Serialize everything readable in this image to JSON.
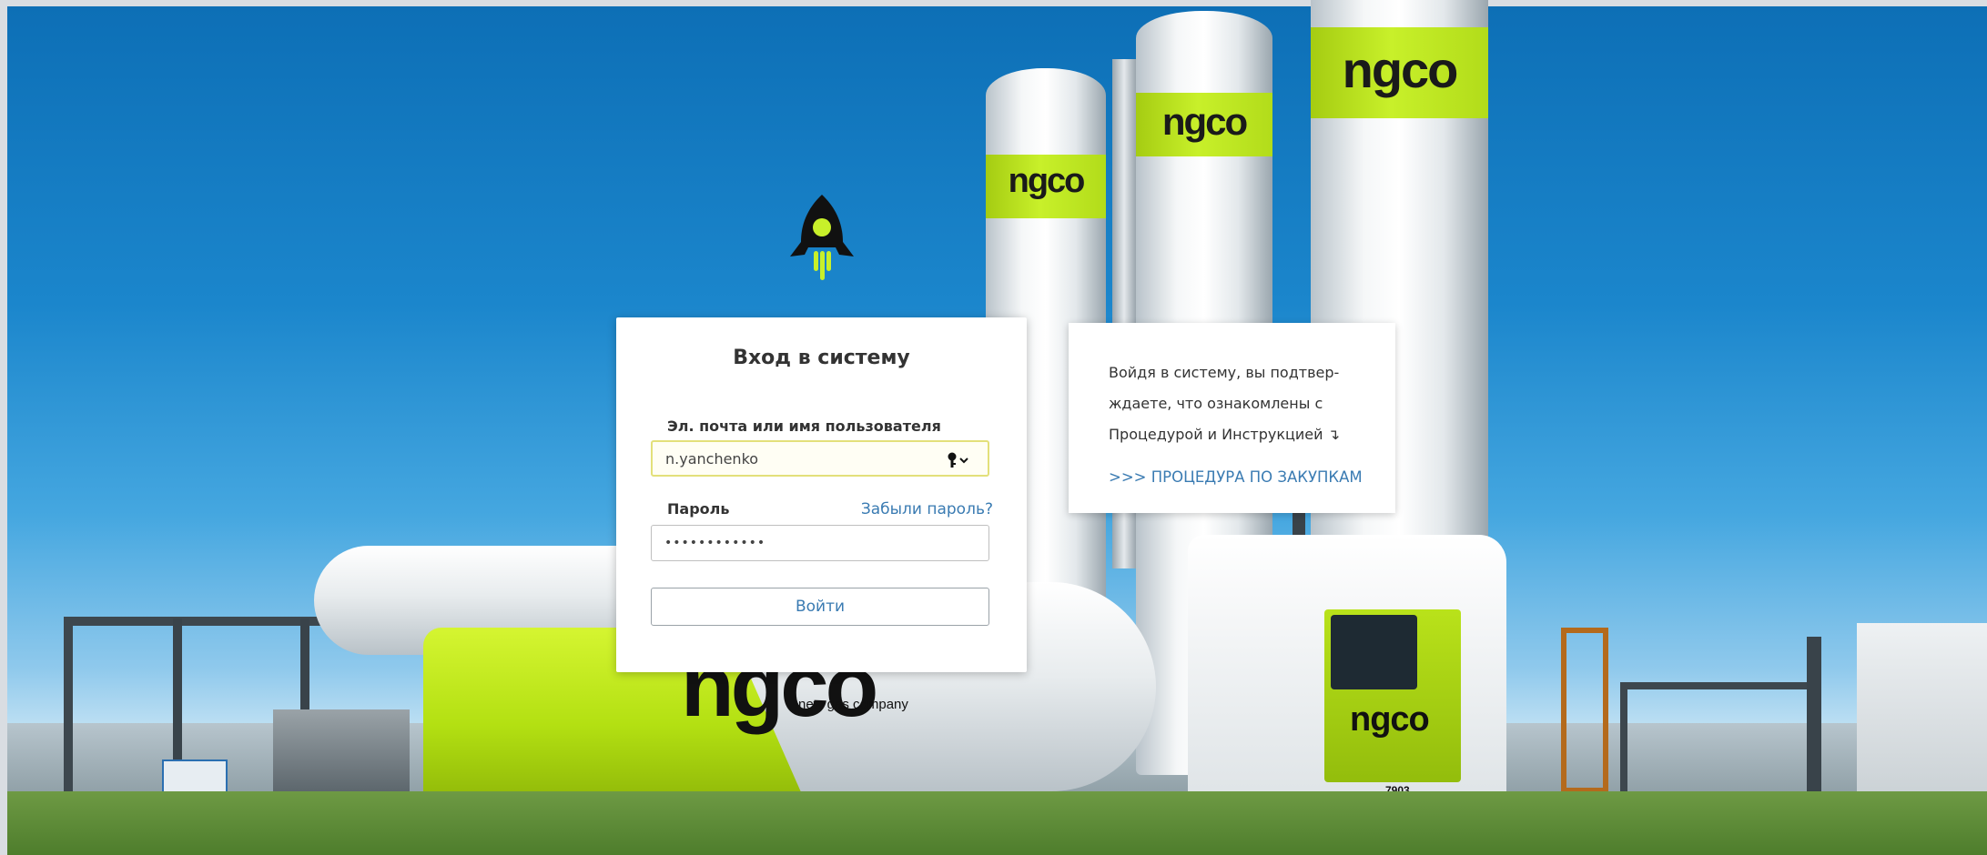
{
  "background": {
    "brand_logo_text": "ngco",
    "brand_tagline": "new gas company",
    "truck_number": "7903"
  },
  "logo": {
    "icon": "rocket-icon",
    "colors": {
      "body": "#111111",
      "accent": "#c8f02a"
    }
  },
  "login": {
    "title": "Вход в систему",
    "email_label": "Эл. почта или имя пользователя",
    "email_value": "n.yanchenko",
    "password_label": "Пароль",
    "forgot_link": "Забыли пароль?",
    "password_value": "••••••••••••",
    "submit_label": "Войти"
  },
  "info": {
    "line1": "Войдя в систему, вы подтвер-",
    "line2": "ждаете, что ознакомлены с",
    "line3": "Процедурой и Инструкцией ↴",
    "procurement_link": ">>> ПРОЦЕДУРА ПО ЗАКУПКАМ"
  },
  "colors": {
    "link": "#3a7bb2",
    "brand_green": "#c8f02a"
  }
}
